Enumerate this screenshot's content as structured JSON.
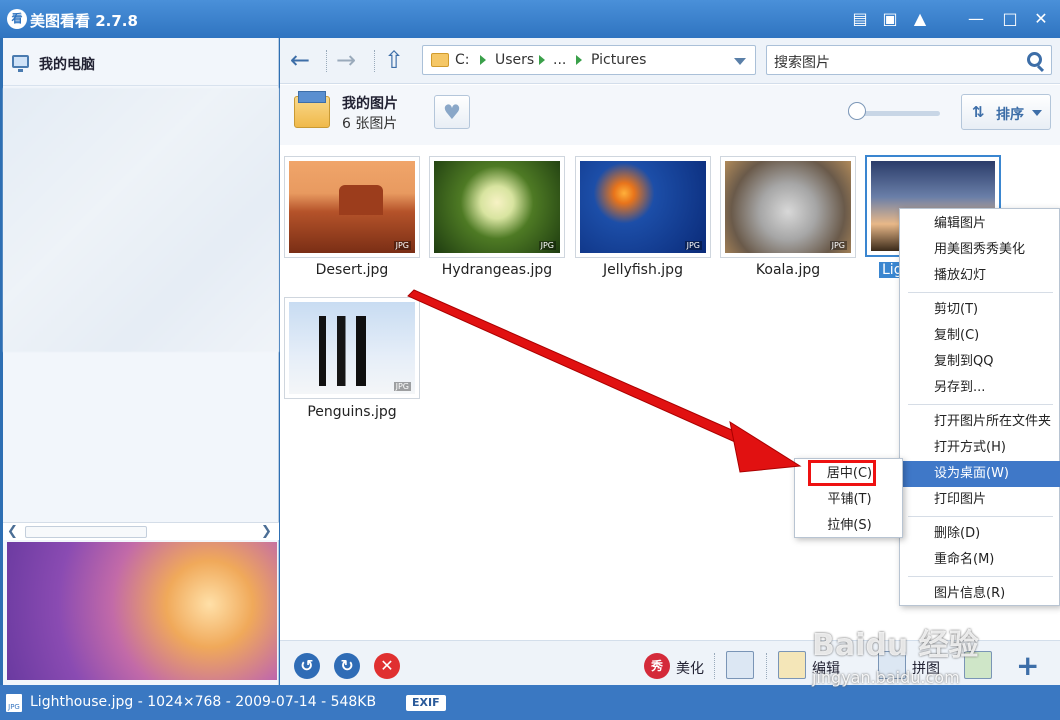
{
  "app": {
    "logo_char": "看",
    "title": "美图看看 2.7.8"
  },
  "titlebar_icons": [
    "chat-icon",
    "dropdown-box-icon",
    "tshirt-icon",
    "minimize-icon",
    "maximize-icon",
    "close-icon"
  ],
  "left_panel": {
    "title": "我的电脑"
  },
  "nav": {
    "breadcrumb": [
      "C:",
      "Users",
      "...",
      "Pictures"
    ],
    "search_placeholder": "搜索图片"
  },
  "folder": {
    "name": "我的图片",
    "count": "6 张图片",
    "sort_label": "排序"
  },
  "thumbnails": [
    {
      "name": "Desert.jpg"
    },
    {
      "name": "Hydrangeas.jpg"
    },
    {
      "name": "Jellyfish.jpg"
    },
    {
      "name": "Koala.jpg"
    },
    {
      "name": "Lig",
      "selected": true
    },
    {
      "name": "Penguins.jpg"
    }
  ],
  "thumb_badge": "JPG",
  "context_menu": [
    "编辑图片",
    "用美图秀秀美化",
    "播放幻灯",
    "剪切(T)",
    "复制(C)",
    "复制到QQ",
    "另存到...",
    "打开图片所在文件夹",
    "打开方式(H)",
    "设为桌面(W)",
    "打印图片",
    "删除(D)",
    "重命名(M)",
    "图片信息(R)"
  ],
  "submenu": [
    "居中(C)",
    "平铺(T)",
    "拉伸(S)"
  ],
  "bottom_toolbar": {
    "beautify_icon_char": "秀",
    "beautify": "美化",
    "edit": "编辑",
    "puzzle": "拼图"
  },
  "status": {
    "badge": "JPG",
    "text": "Lighthouse.jpg - 1024×768 - 2009-07-14 - 548KB",
    "exif": "EXIF"
  },
  "watermark": {
    "main": "Baidu 经验",
    "sub": "jingyan.baidu.com"
  },
  "colors": {
    "accent": "#3a78c2",
    "highlight": "#3f78c8",
    "annotation": "#e11111"
  }
}
